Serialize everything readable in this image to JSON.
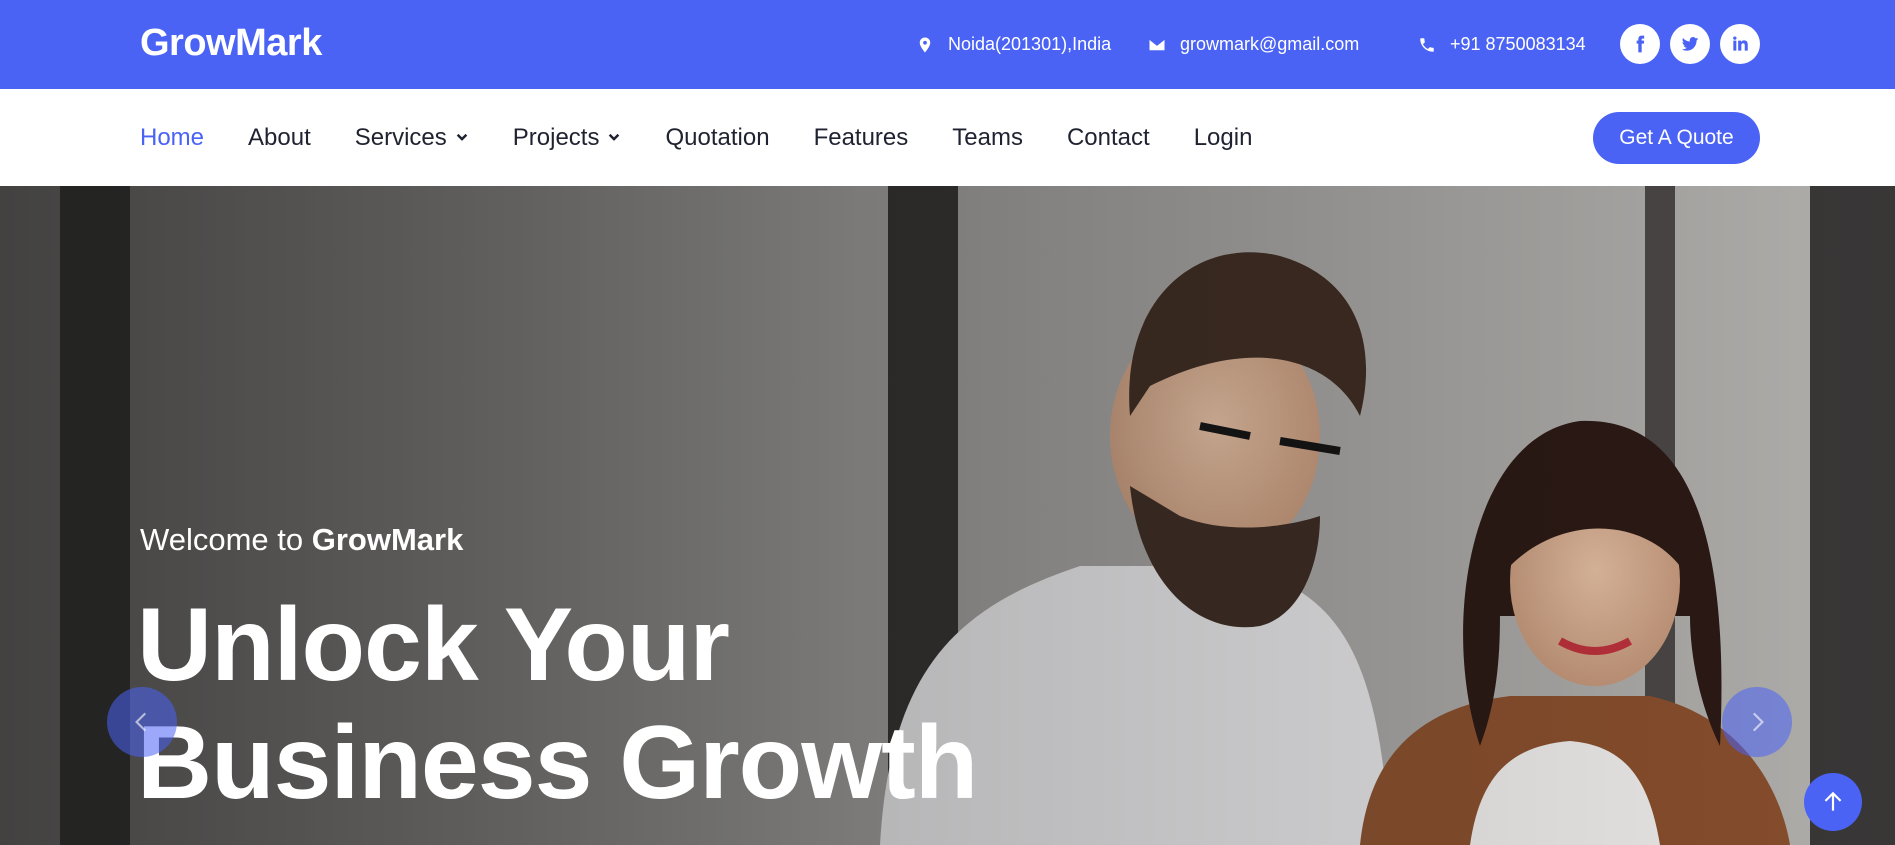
{
  "brand": "GrowMark",
  "contact": {
    "location": "Noida(201301),India",
    "email": "growmark@gmail.com",
    "phone": "+91 8750083134"
  },
  "socials": [
    "facebook-icon",
    "twitter-icon",
    "linkedin-icon"
  ],
  "nav": {
    "items": [
      {
        "label": "Home"
      },
      {
        "label": "About"
      },
      {
        "label": "Services"
      },
      {
        "label": "Projects"
      },
      {
        "label": "Quotation"
      },
      {
        "label": "Features"
      },
      {
        "label": "Teams"
      },
      {
        "label": "Contact"
      },
      {
        "label": "Login"
      }
    ],
    "cta": "Get A Quote"
  },
  "hero": {
    "welcome_prefix": "Welcome to",
    "welcome_brand": "GrowMark",
    "line1": "Unlock Your",
    "line2": "Business Growth"
  },
  "colors": {
    "accent": "#4a63f5"
  }
}
